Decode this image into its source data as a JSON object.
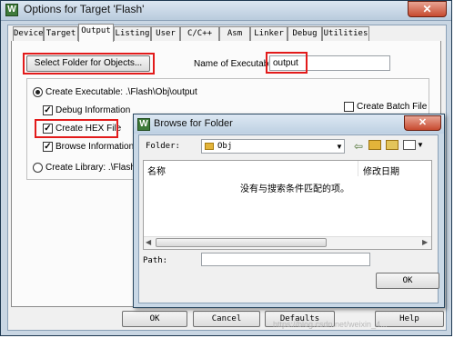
{
  "window": {
    "title": "Options for Target 'Flash'",
    "app_icon_glyph": "W",
    "close_glyph": "✕"
  },
  "tabs": [
    {
      "label": "Device"
    },
    {
      "label": "Target"
    },
    {
      "label": "Output"
    },
    {
      "label": "Listing"
    },
    {
      "label": "User"
    },
    {
      "label": "C/C++"
    },
    {
      "label": "Asm"
    },
    {
      "label": "Linker"
    },
    {
      "label": "Debug"
    },
    {
      "label": "Utilities"
    }
  ],
  "output_tab": {
    "select_folder_label": "Select Folder for Objects...",
    "name_of_executable_label": "Name of Executable:",
    "name_of_executable_value": "output",
    "create_executable_label": "Create Executable:  .\\Flash\\Obj\\output",
    "debug_info_label": "Debug Information",
    "create_hex_label": "Create HEX File",
    "browse_info_label": "Browse Information",
    "create_library_label": "Create Library:  .\\Flash\\Ob",
    "create_batch_label": "Create Batch File",
    "check_glyph": "✓"
  },
  "browse_dialog": {
    "title": "Browse for Folder",
    "folder_label": "Folder:",
    "folder_value": "Obj",
    "col_name": "名称",
    "col_modified": "修改日期",
    "empty_message": "没有与搜索条件匹配的项。",
    "path_label": "Path:",
    "path_value": "",
    "ok_label": "OK",
    "close_glyph": "✕"
  },
  "footer": {
    "ok_label": "OK",
    "cancel_label": "Cancel",
    "defaults_label": "Defaults",
    "help_label": "Help"
  },
  "watermark": "https://blog.csdn.net/weixin_4..."
}
